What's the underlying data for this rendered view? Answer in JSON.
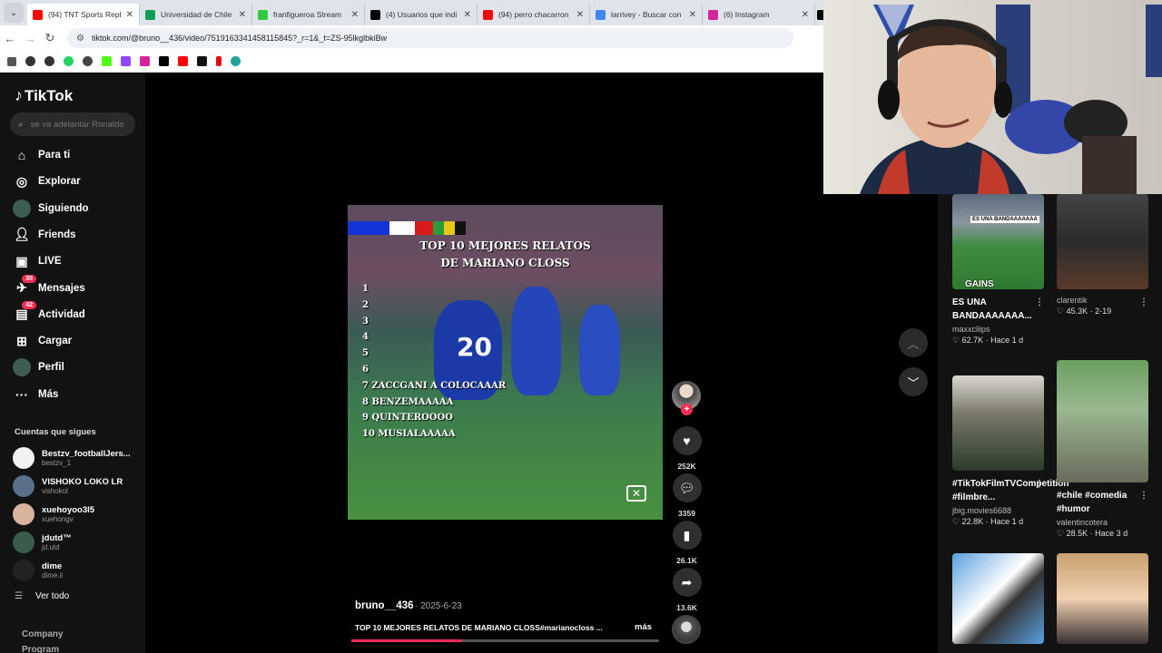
{
  "browser": {
    "tabs": [
      {
        "label": "(94) TNT Sports Repl",
        "color": "#ff0000"
      },
      {
        "label": "Universidad de Chile",
        "color": "#0f9d58"
      },
      {
        "label": "franfigueroa Stream",
        "color": "#2ecc40"
      },
      {
        "label": "(4) Usuarios que indi",
        "color": "#000000"
      },
      {
        "label": "(94) perro chacarron",
        "color": "#ff0000"
      },
      {
        "label": "larrivey - Buscar con",
        "color": "#4285f4"
      },
      {
        "label": "(6) Instagram",
        "color": "#d6249f"
      }
    ],
    "url": "tiktok.com/@bruno__436/video/7519163341458115845?_r=1&_t=ZS-95lkglbkiBw"
  },
  "sidebar": {
    "logo": "TikTok",
    "search_placeholder": "se va adelantar Ronaldo",
    "nav": [
      {
        "label": "Para ti",
        "icon": "home-icon"
      },
      {
        "label": "Explorar",
        "icon": "compass-icon"
      },
      {
        "label": "Siguiendo",
        "icon": "following-icon"
      },
      {
        "label": "Friends",
        "icon": "friends-icon"
      },
      {
        "label": "LIVE",
        "icon": "live-icon"
      },
      {
        "label": "Mensajes",
        "icon": "messages-icon",
        "badge": "35"
      },
      {
        "label": "Actividad",
        "icon": "activity-icon",
        "badge": "42"
      },
      {
        "label": "Cargar",
        "icon": "upload-icon"
      },
      {
        "label": "Perfil",
        "icon": "profile-icon"
      },
      {
        "label": "Más",
        "icon": "more-icon"
      }
    ],
    "following_title": "Cuentas que sigues",
    "accounts": [
      {
        "name": "Bestzv_footballJers...",
        "handle": "bestzv_1",
        "color": "#f2f2f2"
      },
      {
        "name": "VISHOKO LOKO LR",
        "handle": "vishokol",
        "color": "#5a6f8a"
      },
      {
        "name": "xuehoyoo3l5",
        "handle": "xuehongv",
        "color": "#d8b4a0"
      },
      {
        "name": "jdutd™",
        "handle": "jd.utd",
        "color": "#3a5a4a"
      },
      {
        "name": "dime",
        "handle": "dime.ii",
        "color": "#222222"
      }
    ],
    "see_all": "Ver todo",
    "footer": [
      "Company",
      "Program"
    ]
  },
  "video": {
    "title_line1": "TOP 10 MEJORES RELATOS",
    "title_line2": "DE MARIANO CLOSS",
    "ranks": [
      "1",
      "2",
      "3",
      "4",
      "5",
      "6",
      "7  ZACCGANI A COLOCAAAR",
      "8  BENZEMAAAAA",
      "9  QUINTEROOOO",
      "10  MUSIALAAAAA"
    ],
    "jersey_number": "20",
    "author": "bruno__436",
    "date": "· 2025-6-23",
    "description": "TOP 10 MEJORES RELATOS DE MARIANO CLOSS#marianocloss ...",
    "more": "más",
    "progress": 0.36,
    "likes": "252K",
    "comments": "3359",
    "saves": "26.1K",
    "shares": "13.6K"
  },
  "feed": [
    {
      "title": "ES UNA BANDAAAAAAA...",
      "author": "maxxcliips",
      "likes": "62.7K",
      "ago": "Hace 1 d",
      "thumb_text": "ES UNA BANDAAAAAAA",
      "thumb_brand": "GAINS"
    },
    {
      "title": "",
      "author": "clarentik",
      "likes": "45.3K",
      "ago": "2-19"
    },
    {
      "title": "#TikTokFilmTVCompetition #filmbre...",
      "author": "jbig.movies6688",
      "likes": "22.8K",
      "ago": "Hace 1 d"
    },
    {
      "title": "#chile #comedia #humor",
      "author": "valentincotera",
      "likes": "28.5K",
      "ago": "Hace 3 d"
    },
    {
      "title": "",
      "author": "",
      "likes": "",
      "ago": ""
    },
    {
      "title": "",
      "author": "",
      "likes": "",
      "ago": ""
    }
  ]
}
